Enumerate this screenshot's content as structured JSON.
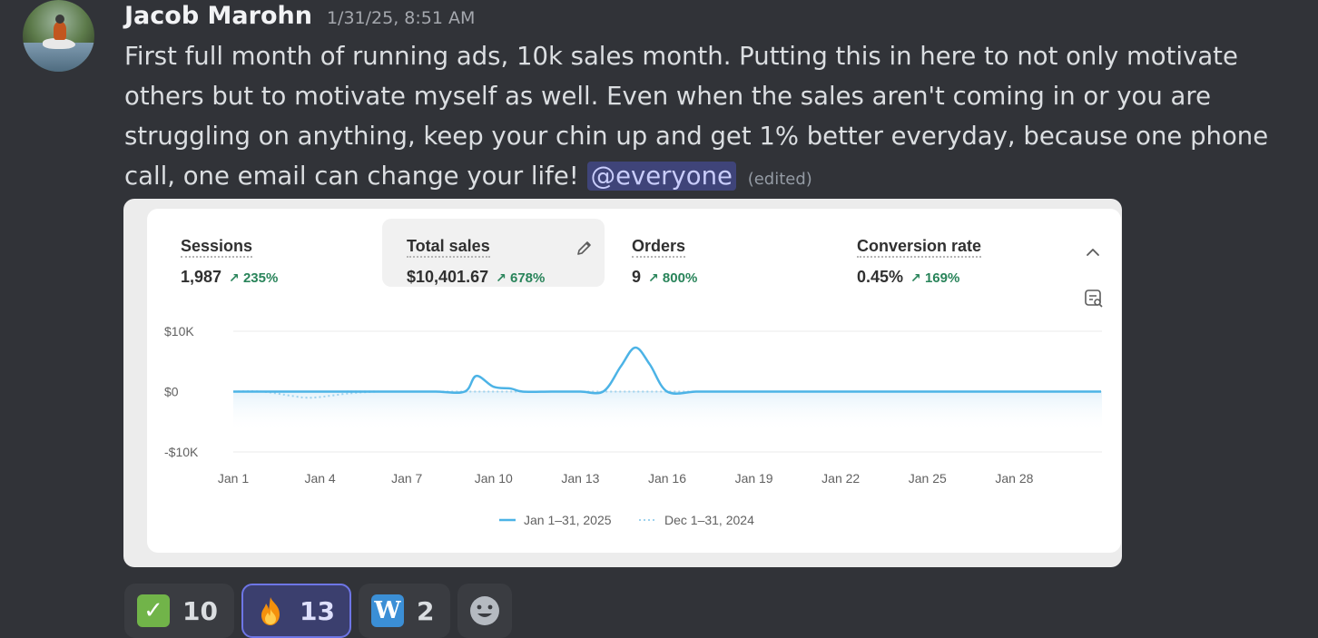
{
  "message": {
    "author": "Jacob Marohn",
    "timestamp": "1/31/25, 8:51 AM",
    "text": "First full month of running ads, 10k sales month. Putting this in here to not only motivate others but to motivate myself as well. Even when the sales aren't coming in or you are struggling on anything, keep your chin up and get 1% better everyday, because one phone call, one email can change your life!",
    "mention": "@everyone",
    "edited_label": "(edited)"
  },
  "metrics": [
    {
      "label": "Sessions",
      "value": "1,987",
      "change": "235%"
    },
    {
      "label": "Total sales",
      "value": "$10,401.67",
      "change": "678%"
    },
    {
      "label": "Orders",
      "value": "9",
      "change": "800%"
    },
    {
      "label": "Conversion rate",
      "value": "0.45%",
      "change": "169%"
    }
  ],
  "chart_data": {
    "type": "line",
    "y_tick_labels": [
      "$10K",
      "$0",
      "-$10K"
    ],
    "ylim": [
      -10000,
      10000
    ],
    "x_tick_labels": [
      "Jan 1",
      "Jan 4",
      "Jan 7",
      "Jan 10",
      "Jan 13",
      "Jan 16",
      "Jan 19",
      "Jan 22",
      "Jan 25",
      "Jan 28"
    ],
    "x_tick_days": [
      1,
      4,
      7,
      10,
      13,
      16,
      19,
      22,
      25,
      28
    ],
    "x_range_days": [
      1,
      31
    ],
    "grid": true,
    "legend_position": "bottom-center",
    "series": [
      {
        "name": "Jan 1–31, 2025",
        "style": "solid",
        "color": "#4cb3e6",
        "x": [
          1,
          2,
          3,
          4,
          5,
          6,
          7,
          8,
          9,
          9.4,
          10,
          10.6,
          11,
          12,
          13,
          13.8,
          14.4,
          14.9,
          15.4,
          16,
          17,
          18,
          19,
          20,
          21,
          22,
          23,
          24,
          25,
          26,
          27,
          28,
          29,
          30,
          31
        ],
        "values": [
          0,
          0,
          0,
          0,
          0,
          0,
          0,
          0,
          0,
          2600,
          800,
          500,
          0,
          0,
          0,
          50,
          4200,
          7300,
          4500,
          0,
          0,
          0,
          0,
          0,
          0,
          0,
          0,
          0,
          0,
          0,
          0,
          0,
          0,
          0,
          0
        ]
      },
      {
        "name": "Dec 1–31, 2024",
        "style": "dotted",
        "color": "#9fd3ee",
        "x": [
          1,
          2,
          3,
          3.5,
          4,
          5,
          6,
          7,
          31
        ],
        "values": [
          0,
          0,
          -700,
          -1000,
          -900,
          -300,
          0,
          0,
          0
        ]
      }
    ]
  },
  "reactions": [
    {
      "emoji": "check-mark-emoji",
      "count": "10",
      "selected": false
    },
    {
      "emoji": "fire-emoji",
      "count": "13",
      "selected": true
    },
    {
      "emoji": "w-emoji",
      "glyph": "W",
      "count": "2",
      "selected": false
    }
  ]
}
